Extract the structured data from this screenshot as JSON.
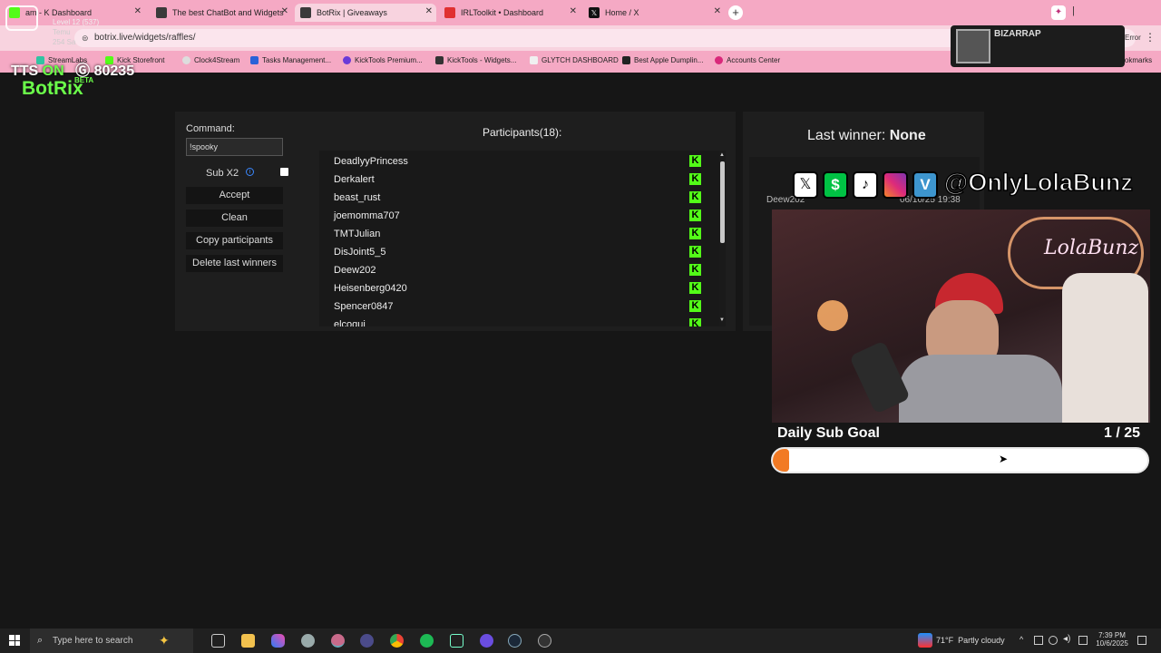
{
  "browser": {
    "tabs": [
      {
        "title": "am - K Dashboard",
        "fav_color": "#53fc18"
      },
      {
        "title": "The best ChatBot and Widgets",
        "fav_color": "#3a3a3a"
      },
      {
        "title": "BotRix | Giveaways",
        "fav_color": "#3a3a3a"
      },
      {
        "title": "IRLToolkit • Dashboard",
        "fav_color": "#e03030"
      },
      {
        "title": "Home / X",
        "fav_color": "#111111"
      }
    ],
    "url": "botrix.live/widgets/raffles/",
    "error_label": "Error",
    "bookmarks": [
      "StreamLabs",
      "Kick Storefront",
      "Clock4Stream",
      "Tasks Management...",
      "KickTools Premium...",
      "KickTools - Widgets...",
      "GLYTCH DASHBOARD",
      "Best Apple Dumplin...",
      "Accounts Center"
    ],
    "all_bookmarks": "All Bookmarks"
  },
  "overlay": {
    "tts_label": "TTS",
    "tts_state": "ON",
    "points": "80235",
    "level_text": "Level 12 (537)",
    "sub_text_1": "Temu",
    "sub_text_2": "254 Sa",
    "spotify_title": "BIZARRAP",
    "social_handle": "@OnlyLolaBunz",
    "goal_title": "Daily Sub Goal",
    "goal_count": "1 / 25",
    "goal_progress": 0.04
  },
  "app": {
    "logo": "BotRix",
    "beta": "BETA",
    "command_label": "Command:",
    "command_value": "!spooky",
    "sub_label": "Sub X2",
    "buttons": {
      "accept": "Accept",
      "clean": "Clean",
      "copy": "Copy participants",
      "delete": "Delete last winners"
    },
    "participants_title": "Participants(18):",
    "participants": [
      "DeadlyyPrincess",
      "Derkalert",
      "beast_rust",
      "joemomma707",
      "TMTJulian",
      "DisJoint5_5",
      "Deew202",
      "Heisenberg0420",
      "Spencer0847",
      "elcoqui"
    ],
    "last_winner_label": "Last winner:",
    "last_winner_value": "None",
    "winner_name": "Deew202",
    "winner_time": "06/10/25 19:38"
  },
  "taskbar": {
    "search_placeholder": "Type here to search",
    "weather": "71°F  Partly cloudy",
    "time": "7:39 PM",
    "date": "10/6/2025"
  }
}
